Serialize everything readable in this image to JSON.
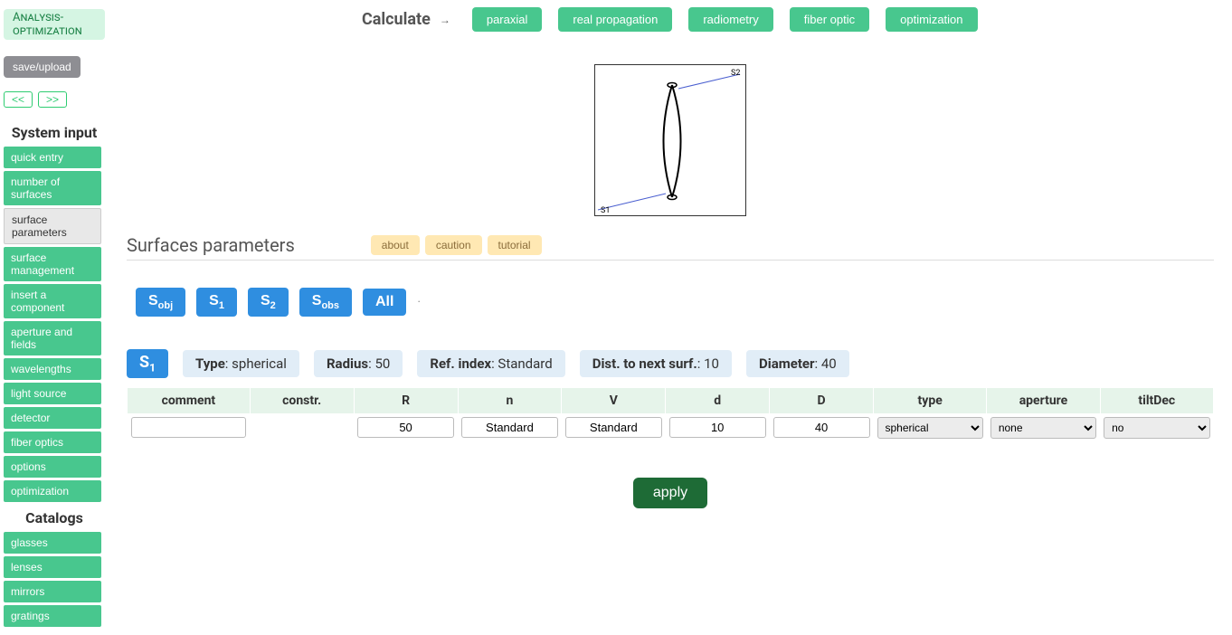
{
  "badge": "Analysis-optimization",
  "save_upload": "save/upload",
  "nav": {
    "prev": "<<",
    "next": ">>"
  },
  "sidebar": {
    "system_input_title": "System input",
    "items": [
      {
        "label": "quick entry",
        "active": false
      },
      {
        "label": "number of surfaces",
        "active": false
      },
      {
        "label": "surface parameters",
        "active": true
      },
      {
        "label": "surface management",
        "active": false
      },
      {
        "label": "insert a component",
        "active": false
      },
      {
        "label": "aperture and fields",
        "active": false
      },
      {
        "label": "wavelengths",
        "active": false
      },
      {
        "label": "light source",
        "active": false
      },
      {
        "label": "detector",
        "active": false
      },
      {
        "label": "fiber optics",
        "active": false
      },
      {
        "label": "options",
        "active": false
      },
      {
        "label": "optimization",
        "active": false
      }
    ],
    "catalogs_title": "Catalogs",
    "catalogs": [
      {
        "label": "glasses"
      },
      {
        "label": "lenses"
      },
      {
        "label": "mirrors"
      },
      {
        "label": "gratings"
      }
    ]
  },
  "topbar": {
    "calculate_label": "Calculate",
    "buttons": [
      {
        "label": "paraxial"
      },
      {
        "label": "real propagation"
      },
      {
        "label": "radiometry"
      },
      {
        "label": "fiber optic"
      },
      {
        "label": "optimization"
      }
    ]
  },
  "diagram": {
    "s1_label": "S1",
    "s2_label": "S2"
  },
  "section": {
    "title": "Surfaces parameters"
  },
  "help": {
    "about": "about",
    "caution": "caution",
    "tutorial": "tutorial"
  },
  "surface_tabs": {
    "sobj": "obj",
    "s1": "1",
    "s2": "2",
    "sobs": "obs",
    "all": "All"
  },
  "summary": {
    "surface_sub": "1",
    "type_label": "Type",
    "type_value": "spherical",
    "radius_label": "Radius",
    "radius_value": "50",
    "refindex_label": "Ref. index",
    "refindex_value": "Standard",
    "dist_label": "Dist. to next surf.",
    "dist_value": "10",
    "diameter_label": "Diameter",
    "diameter_value": "40"
  },
  "table": {
    "headers": {
      "comment": "comment",
      "constr": "constr.",
      "R": "R",
      "n": "n",
      "V": "V",
      "d": "d",
      "D": "D",
      "type": "type",
      "aperture": "aperture",
      "tiltDec": "tiltDec"
    },
    "row": {
      "comment": "",
      "constr": "",
      "R": "50",
      "n": "Standard",
      "V": "Standard",
      "d": "10",
      "D": "40",
      "type_options": [
        "spherical"
      ],
      "type_value": "spherical",
      "aperture_options": [
        "none"
      ],
      "aperture_value": "none",
      "tilt_options": [
        "no"
      ],
      "tilt_value": "no"
    }
  },
  "apply_label": "apply"
}
